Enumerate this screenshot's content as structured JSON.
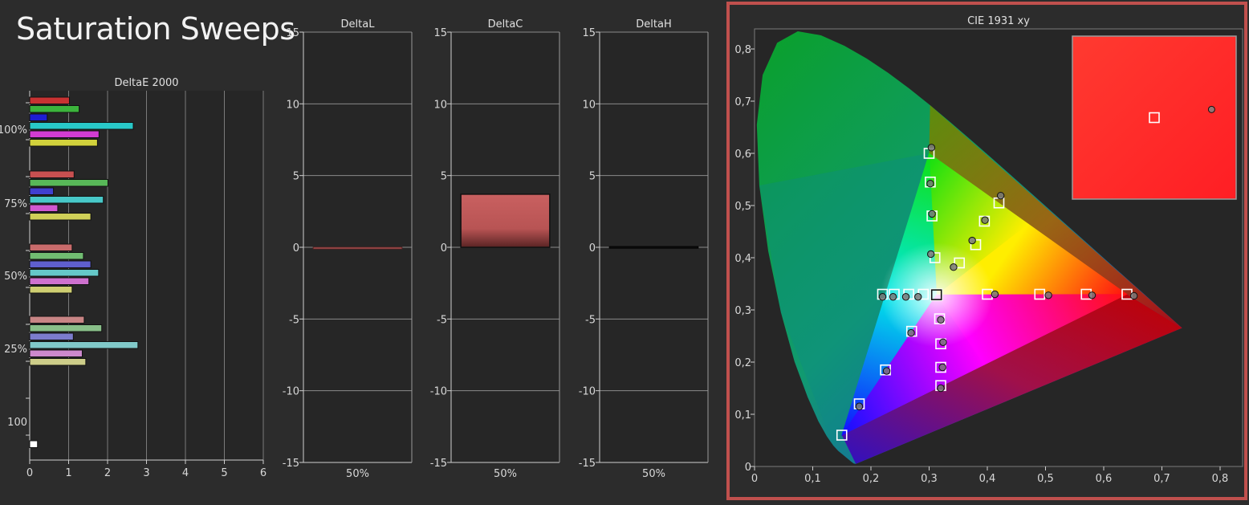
{
  "page_title": "Saturation Sweeps",
  "colors": {
    "background": "#2c2c2c",
    "plot_bg": "#262626",
    "grid": "#888888",
    "highlight_border": "#c0504d",
    "red": "#c83232",
    "green": "#3cb43c",
    "blue": "#1e1ed2",
    "cyan": "#28c8c8",
    "magenta": "#d23cd2",
    "yellow": "#d2d23c"
  },
  "chart_data": [
    {
      "id": "deltae",
      "type": "bar",
      "orientation": "horizontal",
      "title": "DeltaE 2000",
      "xlim": [
        0,
        6
      ],
      "x_ticks": [
        "0",
        "1",
        "2",
        "3",
        "4",
        "5",
        "6"
      ],
      "group_labels": [
        "100%",
        "75%",
        "50%",
        "25%",
        "100"
      ],
      "groups": [
        {
          "label": "100%",
          "bars": [
            {
              "color": "red",
              "value": 1.02
            },
            {
              "color": "green",
              "value": 1.27
            },
            {
              "color": "blue",
              "value": 0.45
            },
            {
              "color": "cyan",
              "value": 2.66
            },
            {
              "color": "magenta",
              "value": 1.78
            },
            {
              "color": "yellow",
              "value": 1.74
            }
          ]
        },
        {
          "label": "75%",
          "bars": [
            {
              "color": "red",
              "value": 1.14
            },
            {
              "color": "green",
              "value": 2.01
            },
            {
              "color": "blue",
              "value": 0.61
            },
            {
              "color": "cyan",
              "value": 1.89
            },
            {
              "color": "magenta",
              "value": 0.72
            },
            {
              "color": "yellow",
              "value": 1.57
            }
          ]
        },
        {
          "label": "50%",
          "bars": [
            {
              "color": "red",
              "value": 1.09
            },
            {
              "color": "green",
              "value": 1.38
            },
            {
              "color": "blue",
              "value": 1.57
            },
            {
              "color": "cyan",
              "value": 1.77
            },
            {
              "color": "magenta",
              "value": 1.52
            },
            {
              "color": "yellow",
              "value": 1.09
            }
          ]
        },
        {
          "label": "25%",
          "bars": [
            {
              "color": "red",
              "value": 1.4
            },
            {
              "color": "green",
              "value": 1.85
            },
            {
              "color": "blue",
              "value": 1.12
            },
            {
              "color": "cyan",
              "value": 2.78
            },
            {
              "color": "magenta",
              "value": 1.35
            },
            {
              "color": "yellow",
              "value": 1.44
            }
          ]
        },
        {
          "label": "100",
          "bars": [
            {
              "color": "white",
              "value": 0.2
            }
          ]
        }
      ]
    },
    {
      "id": "deltal",
      "type": "bar",
      "title": "DeltaL",
      "ylim": [
        -15,
        15
      ],
      "y_ticks": [
        "15",
        "10",
        "5",
        "0",
        "-5",
        "-10",
        "-15"
      ],
      "categories": [
        "50%"
      ],
      "values": [
        -0.1
      ]
    },
    {
      "id": "deltac",
      "type": "bar",
      "title": "DeltaC",
      "ylim": [
        -15,
        15
      ],
      "y_ticks": [
        "15",
        "10",
        "5",
        "0",
        "-5",
        "-10",
        "-15"
      ],
      "categories": [
        "50%"
      ],
      "values": [
        3.7
      ]
    },
    {
      "id": "deltah",
      "type": "bar",
      "title": "DeltaH",
      "ylim": [
        -15,
        15
      ],
      "y_ticks": [
        "15",
        "10",
        "5",
        "0",
        "-5",
        "-10",
        "-15"
      ],
      "categories": [
        "50%"
      ],
      "values": [
        0.05
      ]
    },
    {
      "id": "cie",
      "type": "scatter",
      "title": "CIE 1931 xy",
      "xlim": [
        0,
        0.82
      ],
      "ylim": [
        0,
        0.84
      ],
      "x_ticks": [
        "0",
        "0,1",
        "0,2",
        "0,3",
        "0,4",
        "0,5",
        "0,6",
        "0,7",
        "0,8"
      ],
      "y_ticks": [
        "0",
        "0,1",
        "0,2",
        "0,3",
        "0,4",
        "0,5",
        "0,6",
        "0,7",
        "0,8"
      ],
      "gamut_triangle": [
        [
          0.64,
          0.33
        ],
        [
          0.3,
          0.6
        ],
        [
          0.15,
          0.06
        ]
      ],
      "white_point": [
        0.3127,
        0.329
      ],
      "targets": [
        [
          0.3127,
          0.329
        ],
        [
          0.4,
          0.33
        ],
        [
          0.49,
          0.33
        ],
        [
          0.57,
          0.33
        ],
        [
          0.64,
          0.33
        ],
        [
          0.302,
          0.545
        ],
        [
          0.305,
          0.48
        ],
        [
          0.31,
          0.4
        ],
        [
          0.3,
          0.6
        ],
        [
          0.27,
          0.259
        ],
        [
          0.225,
          0.185
        ],
        [
          0.18,
          0.12
        ],
        [
          0.15,
          0.06
        ],
        [
          0.29,
          0.33
        ],
        [
          0.265,
          0.33
        ],
        [
          0.24,
          0.33
        ],
        [
          0.22,
          0.33
        ],
        [
          0.318,
          0.283
        ],
        [
          0.32,
          0.235
        ],
        [
          0.32,
          0.19
        ],
        [
          0.32,
          0.155
        ],
        [
          0.352,
          0.39
        ],
        [
          0.38,
          0.425
        ],
        [
          0.395,
          0.47
        ],
        [
          0.42,
          0.505
        ]
      ],
      "measured": [
        [
          0.413,
          0.33
        ],
        [
          0.505,
          0.328
        ],
        [
          0.58,
          0.328
        ],
        [
          0.652,
          0.327
        ],
        [
          0.304,
          0.611
        ],
        [
          0.302,
          0.542
        ],
        [
          0.305,
          0.484
        ],
        [
          0.303,
          0.407
        ],
        [
          0.269,
          0.256
        ],
        [
          0.227,
          0.183
        ],
        [
          0.18,
          0.115
        ],
        [
          0.281,
          0.325
        ],
        [
          0.26,
          0.325
        ],
        [
          0.238,
          0.325
        ],
        [
          0.22,
          0.325
        ],
        [
          0.32,
          0.281
        ],
        [
          0.324,
          0.238
        ],
        [
          0.323,
          0.19
        ],
        [
          0.32,
          0.15
        ],
        [
          0.342,
          0.382
        ],
        [
          0.374,
          0.433
        ],
        [
          0.396,
          0.472
        ],
        [
          0.423,
          0.519
        ]
      ],
      "inset": {
        "title": "",
        "target": [
          0.5,
          0.5
        ],
        "measured": [
          0.85,
          0.45
        ]
      }
    }
  ]
}
